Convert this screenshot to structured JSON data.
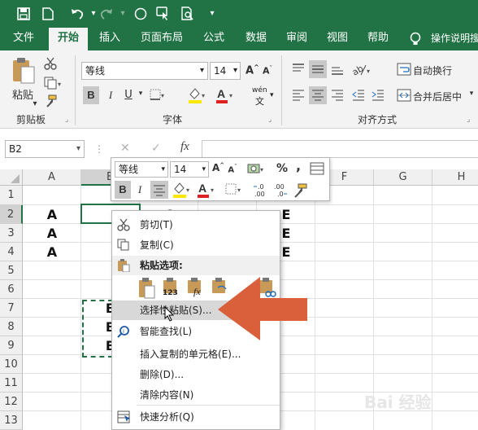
{
  "quick_access": {
    "undo_dropdown": "▾",
    "customize": "▾"
  },
  "tabs": [
    "文件",
    "开始",
    "插入",
    "页面布局",
    "公式",
    "数据",
    "审阅",
    "视图",
    "帮助"
  ],
  "tell_me": "操作说明搜",
  "ribbon": {
    "paste_label": "粘贴",
    "clipboard_label": "剪贴板",
    "font_name": "等线",
    "font_size": "14",
    "font_group_label": "字体",
    "bold": "B",
    "italic": "I",
    "underline": "U",
    "font_color_glyph": "A",
    "wen": "wén",
    "wrap_text": "自动换行",
    "merge_center": "合并后居中",
    "align_group_label": "对齐方式"
  },
  "formula_bar": {
    "name_box": "B2",
    "fx": "fx"
  },
  "grid": {
    "columns": [
      "A",
      "B",
      "C",
      "D",
      "E",
      "F",
      "G",
      "H"
    ],
    "rows": [
      "1",
      "2",
      "3",
      "4",
      "5",
      "6",
      "7",
      "8",
      "9",
      "10",
      "11",
      "12",
      "13"
    ],
    "cells": {
      "A2": "A",
      "A3": "A",
      "A4": "A",
      "C2": "C",
      "E2": "E",
      "E3": "E",
      "E4": "E",
      "B7": "B",
      "B8": "B",
      "B9": "B"
    }
  },
  "mini_toolbar": {
    "font_name": "等线",
    "font_size": "14",
    "bold": "B",
    "italic": "I",
    "percent": "%",
    "comma": ",",
    "font_color_glyph": "A",
    "inc_decimal": "←.0\n.00",
    "dec_decimal": ".00\n→.0"
  },
  "context_menu": {
    "cut": "剪切(T)",
    "copy": "复制(C)",
    "paste_options": "粘贴选项:",
    "paste_special": "选择性粘贴(S)...",
    "smart_lookup": "智能查找(L)",
    "insert_copied": "插入复制的单元格(E)...",
    "delete": "删除(D)...",
    "clear": "清除内容(N)",
    "quick_analysis": "快速分析(Q)",
    "paste_icon_123": "123",
    "paste_icon_fx": "fx"
  },
  "watermark": "Bai 经验",
  "colors": {
    "excel_green": "#217346",
    "arrow": "#d9603b"
  }
}
